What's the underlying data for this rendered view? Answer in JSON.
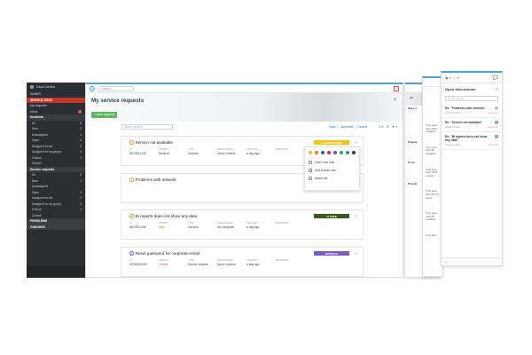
{
  "sidebar": {
    "user_name": "David Jenkins",
    "items": [
      {
        "label": "NAMES",
        "count": "",
        "type": "plain"
      },
      {
        "label": "SERVICE DESK",
        "count": "",
        "type": "desk"
      },
      {
        "label": "My requests",
        "count": "",
        "type": "plain"
      },
      {
        "label": "Inbox",
        "count": "3",
        "type": "badge"
      },
      {
        "label": "Incidents",
        "count": "",
        "type": "section"
      },
      {
        "label": "All",
        "count": "8",
        "type": "sub"
      },
      {
        "label": "New",
        "count": "2",
        "type": "sub"
      },
      {
        "label": "Unassigned",
        "count": "1",
        "type": "sub"
      },
      {
        "label": "Open",
        "count": "4",
        "type": "sub"
      },
      {
        "label": "Assigned to me",
        "count": "2",
        "type": "sub"
      },
      {
        "label": "Assigned to my group",
        "count": "3",
        "type": "sub"
      },
      {
        "label": "Critical",
        "count": "1",
        "type": "sub"
      },
      {
        "label": "Closed",
        "count": "",
        "type": "sub"
      },
      {
        "label": "Service requests",
        "count": "",
        "type": "section"
      },
      {
        "label": "All",
        "count": "6",
        "type": "sub"
      },
      {
        "label": "New",
        "count": "1",
        "type": "sub"
      },
      {
        "label": "Unassigned",
        "count": "",
        "type": "sub"
      },
      {
        "label": "Open",
        "count": "3",
        "type": "sub"
      },
      {
        "label": "Assigned to me",
        "count": "2",
        "type": "sub"
      },
      {
        "label": "Assigned to my group",
        "count": "2",
        "type": "sub"
      },
      {
        "label": "Critical",
        "count": "1",
        "type": "sub"
      },
      {
        "label": "Closed",
        "count": "",
        "type": "sub"
      },
      {
        "label": "PROBLEMS",
        "count": "",
        "type": "section"
      },
      {
        "label": "CHANGES",
        "count": "",
        "type": "section"
      }
    ]
  },
  "topbar": {
    "search_placeholder": "Search..."
  },
  "hero": {
    "title": "My service requests",
    "new_button": "New request"
  },
  "filter": {
    "search_placeholder": "Ticket search...",
    "links": [
      "Open",
      "|",
      "Approval",
      "|",
      "Closed"
    ]
  },
  "tickets": [
    {
      "title": "Service not available",
      "icon": "!",
      "id": "INC0001234",
      "priority": "Medium",
      "priority_class": "",
      "type": "Incident",
      "responsible": "David Jenkins",
      "updated": "a day ago",
      "status": "CLASSIFICATION",
      "status_color": "#f1c40f"
    },
    {
      "title": "Problems with network",
      "icon": "!",
      "id": "",
      "priority": "",
      "priority_class": "",
      "type": "",
      "responsible": "",
      "updated": "",
      "status": "",
      "status_color": ""
    },
    {
      "title": "BI reports does not show any data",
      "icon": "!",
      "id": "INC0001236",
      "priority": "High",
      "priority_class": "high",
      "type": "Incident",
      "responsible": "Not assigned",
      "updated": "a day ago",
      "status": "CLOSED",
      "status_color": "#3d5a1e"
    },
    {
      "title": "Reset password for corporate email",
      "icon": "?",
      "id": "SRS0001235",
      "priority": "Critical",
      "priority_class": "crit",
      "type": "Service request",
      "responsible": "David Jenkins",
      "updated": "a day ago",
      "status": "APPROVAL",
      "status_color": "#7b5cc4"
    }
  ],
  "col_labels": {
    "id": "ID",
    "priority": "PRIORITY",
    "type": "TYPE",
    "responsible": "RESPONSIBLE",
    "updated": "UPDATED",
    "reported": "REPORTED"
  },
  "popup": {
    "colors": [
      "#f1c40f",
      "#e67e22",
      "#3d5a9e",
      "#c0392b",
      "#8e44ad",
      "#27ae60",
      "#16a085",
      "#2c3e50"
    ],
    "items": [
      "Open new chat",
      "Add private note",
      "Attach file"
    ]
  },
  "panel1": {
    "tab": "All",
    "title": "Open d",
    "lines": [
      "Prepare",
      "To do:",
      "Provide"
    ]
  },
  "panel2": {
    "lines": [
      "Time pass ticket SRS available",
      "Time pass ticket BI available",
      "Time pass ticket SRS expired",
      "Time pass ticket BI in 3 hours",
      "Time pass ticket BI available",
      "Time pass"
    ]
  },
  "panel3": {
    "title": "Open discussions",
    "search_placeholder": "Find in results...",
    "items": [
      {
        "title": "Re: \"Problems with network\"",
        "author": "David Jenkins",
        "count": "0",
        "date": "a day ago"
      },
      {
        "title": "Re: \"Service not available\"",
        "author": "David Jenkins",
        "count": "2",
        "date": "a day ago"
      },
      {
        "title": "Re: \"BI reports does not show any data\"",
        "author": "David Jenkins",
        "count": "1",
        "date": "a day ago"
      }
    ]
  }
}
